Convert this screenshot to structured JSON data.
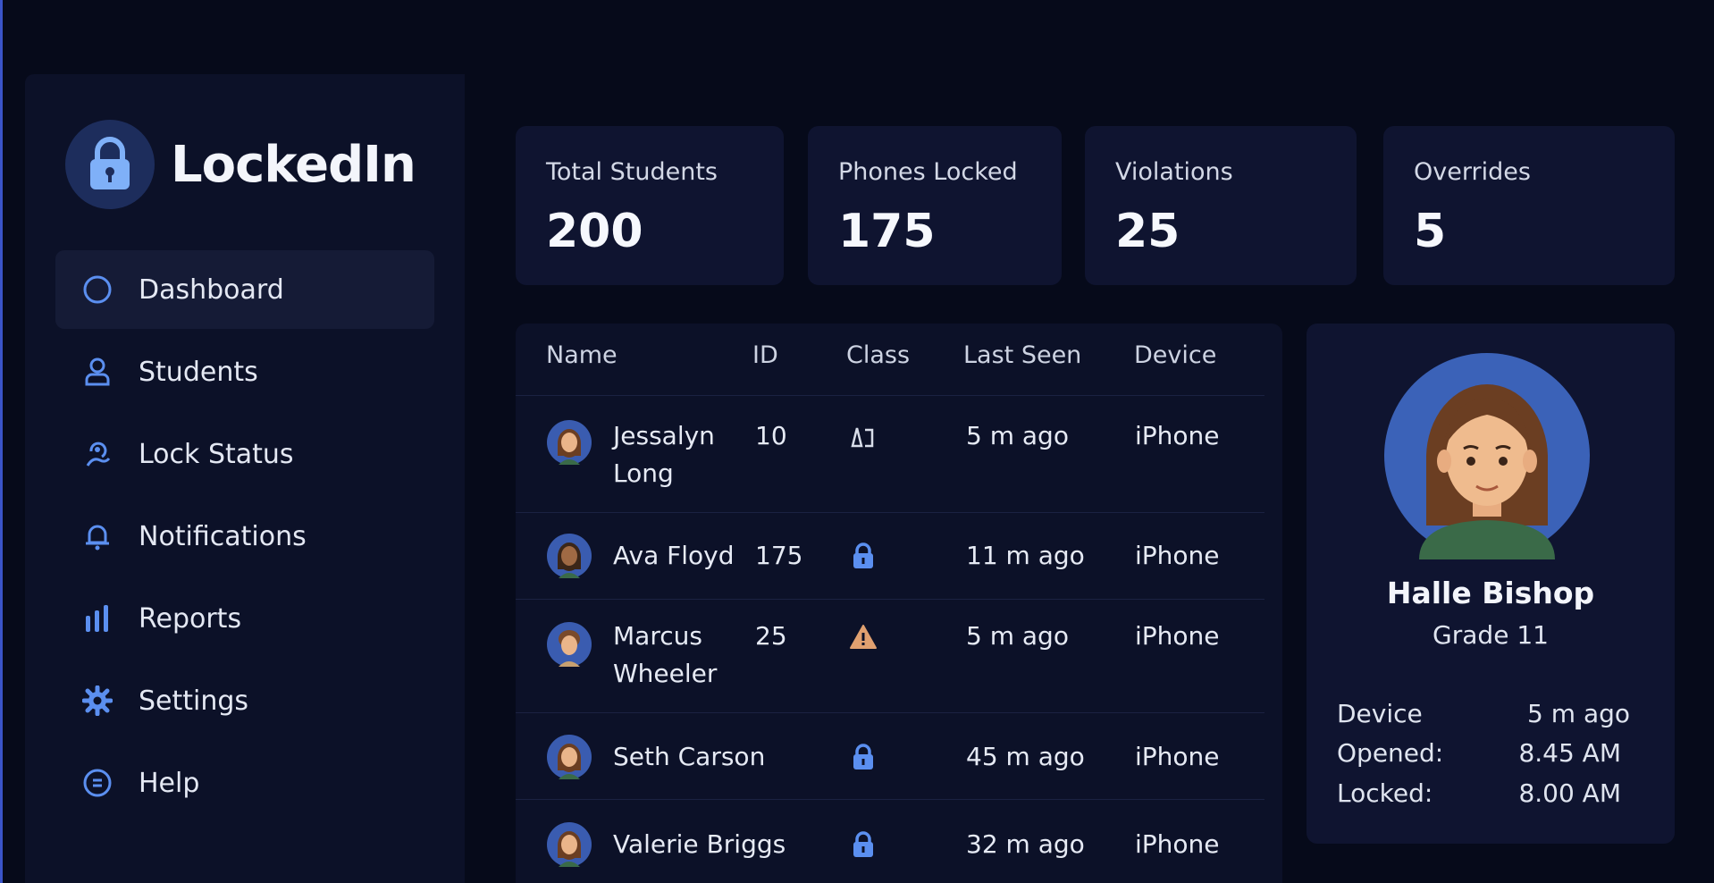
{
  "app": {
    "name": "LockedIn",
    "logo_icon": "padlock-icon"
  },
  "nav": {
    "items": [
      {
        "label": "Dashboard",
        "icon": "circle-icon",
        "active": true
      },
      {
        "label": "Students",
        "icon": "user-icon"
      },
      {
        "label": "Lock Status",
        "icon": "lock-status-icon"
      },
      {
        "label": "Notifications",
        "icon": "bell-icon"
      },
      {
        "label": "Reports",
        "icon": "bar-chart-icon"
      },
      {
        "label": "Settings",
        "icon": "gear-icon"
      },
      {
        "label": "Help",
        "icon": "help-icon"
      }
    ]
  },
  "stats": [
    {
      "label": "Total Students",
      "value": "200"
    },
    {
      "label": "Phones Locked",
      "value": "175"
    },
    {
      "label": "Violations",
      "value": "25"
    },
    {
      "label": "Overrides",
      "value": "5"
    }
  ],
  "table": {
    "headers": [
      "Name",
      "ID",
      "Class",
      "Last Seen",
      "Device"
    ],
    "rows": [
      {
        "name": "Jessalyn Long",
        "id": "10",
        "class_icon": "split-status-icon",
        "last_seen": "5 m ago",
        "device": "iPhone"
      },
      {
        "name": "Ava Floyd",
        "id": "175",
        "class_icon": "lock-icon",
        "last_seen": "11 m ago",
        "device": "iPhone"
      },
      {
        "name": "Marcus Wheeler",
        "id": "25",
        "class_icon": "warning-icon",
        "last_seen": "5 m ago",
        "device": "iPhone"
      },
      {
        "name": "Seth Carson",
        "id": "",
        "class_icon": "lock-icon",
        "last_seen": "45 m ago",
        "device": "iPhone"
      },
      {
        "name": "Valerie Briggs",
        "id": "",
        "class_icon": "lock-icon",
        "last_seen": "32 m ago",
        "device": "iPhone"
      }
    ]
  },
  "profile": {
    "name": "Halle Bishop",
    "grade": "Grade 11",
    "details": [
      {
        "key": "Device",
        "value": "5 m ago"
      },
      {
        "key": "Opened:",
        "value": "8.45 AM"
      },
      {
        "key": "Locked:",
        "value": "8.00 AM"
      }
    ]
  },
  "colors": {
    "background": "#060a1a",
    "panel": "#0c1128",
    "card": "#0f1430",
    "accent": "#5b8ff0",
    "warning": "#e0a070"
  }
}
